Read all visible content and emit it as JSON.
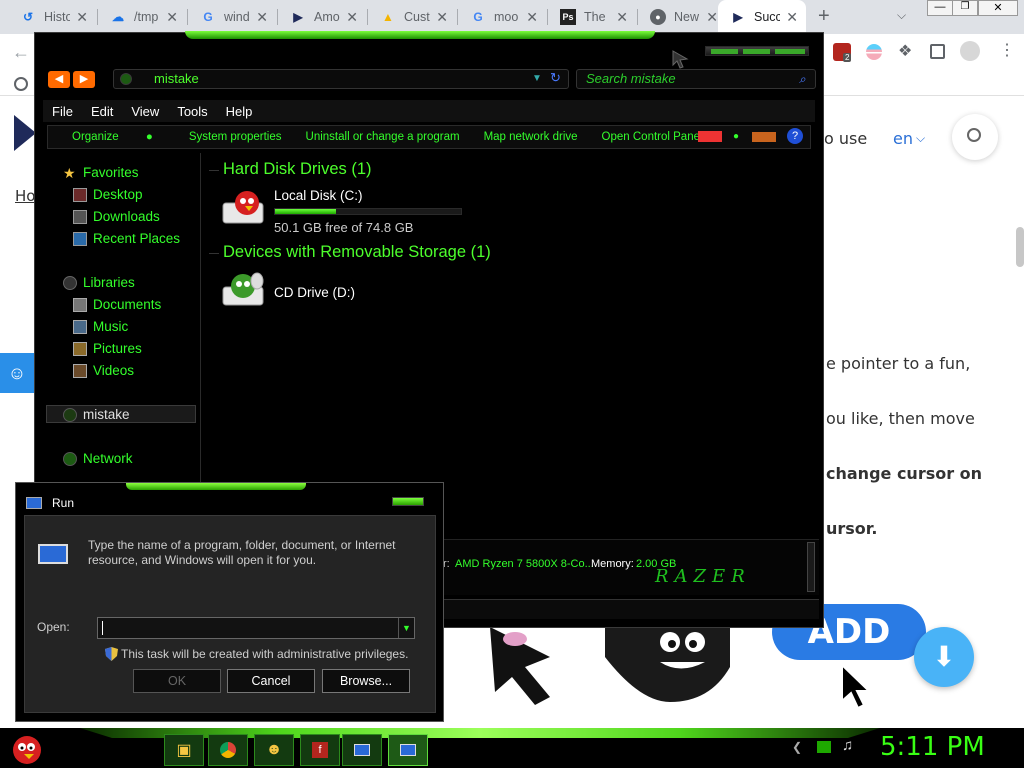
{
  "browser": {
    "tabs": [
      {
        "title": "Histo",
        "icon": "history-icon"
      },
      {
        "title": "/tmp",
        "icon": "cloud-upload-icon"
      },
      {
        "title": "wind",
        "icon": "google-g-icon"
      },
      {
        "title": "Amo",
        "icon": "cursor-arrow-icon"
      },
      {
        "title": "Cust",
        "icon": "drive-icon"
      },
      {
        "title": "moo",
        "icon": "google-g-icon"
      },
      {
        "title": "The",
        "icon": "ps-icon"
      },
      {
        "title": "New",
        "icon": "chrome-icon"
      },
      {
        "title": "Succ",
        "icon": "cursor-arrow-icon"
      }
    ],
    "ext_badge": "2",
    "page": {
      "nav_use": "o use",
      "lang": "en",
      "breadcrumb": "Ho",
      "line1": "e pointer to a fun,",
      "line2": "ou like, then move",
      "line3": "change cursor on",
      "line4": "ursor.",
      "add_button": "ADD"
    }
  },
  "explorer": {
    "address": "mistake",
    "search_placeholder": "Search mistake",
    "menu": [
      "File",
      "Edit",
      "View",
      "Tools",
      "Help"
    ],
    "commands": [
      "Organize",
      "System properties",
      "Uninstall or change a program",
      "Map network drive",
      "Open Control Panel"
    ],
    "nav": {
      "favorites": "Favorites",
      "desktop": "Desktop",
      "downloads": "Downloads",
      "recent": "Recent Places",
      "libraries": "Libraries",
      "documents": "Documents",
      "music": "Music",
      "pictures": "Pictures",
      "videos": "Videos",
      "mistake": "mistake",
      "network": "Network"
    },
    "groups": {
      "hdd": "Hard Disk Drives (1)",
      "removable": "Devices with Removable Storage (1)"
    },
    "drives": {
      "c_name": "Local Disk (C:)",
      "c_free": "50.1 GB free of 74.8 GB",
      "c_used_fraction": 0.33,
      "d_name": "CD Drive (D:)"
    },
    "details": {
      "processor_label": "r:",
      "processor_value": "AMD Ryzen 7 5800X 8-Co...",
      "memory_label": "Memory:",
      "memory_value": "2.00 GB",
      "brand": "RAZER"
    }
  },
  "run": {
    "title": "Run",
    "description": "Type the name of a program, folder, document, or Internet resource, and Windows will open it for you.",
    "open_label": "Open:",
    "input_value": "",
    "admin_note": "This task will be created with administrative privileges.",
    "ok": "OK",
    "cancel": "Cancel",
    "browse": "Browse..."
  },
  "taskbar": {
    "clock": "5:11 PM"
  },
  "colors": {
    "accent_green": "#34ff2c",
    "chrome_tabstrip": "#dee1e6",
    "page_blue": "#2a7be4"
  }
}
